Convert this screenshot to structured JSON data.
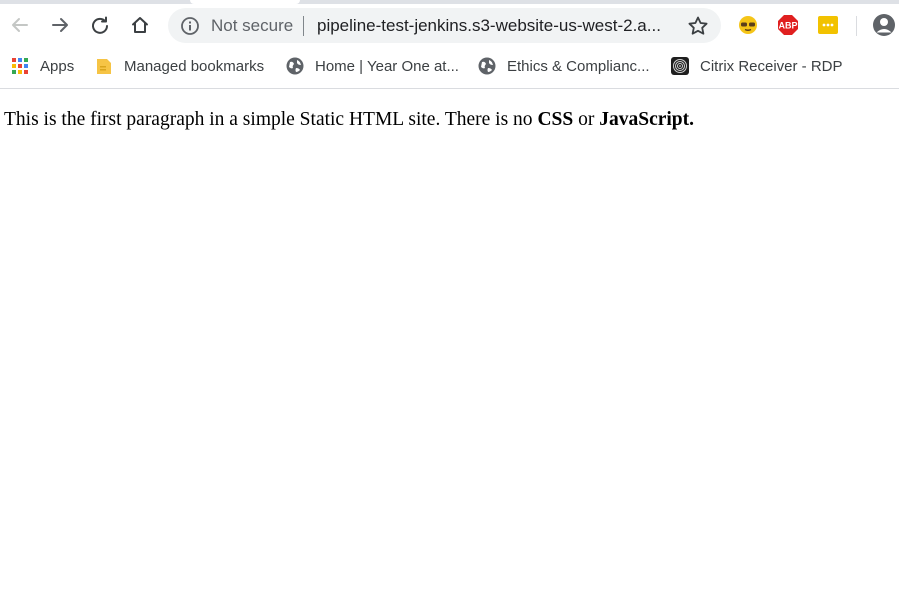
{
  "browser": {
    "security_label": "Not secure",
    "url": "pipeline-test-jenkins.s3-website-us-west-2.a...",
    "extensions": [
      {
        "name": "glasses-extension-icon",
        "color": "#f5c518"
      },
      {
        "name": "adblock-plus-icon",
        "label": "ABP",
        "color": "#e02020"
      },
      {
        "name": "dots-extension-icon",
        "color": "#f2c200"
      }
    ]
  },
  "bookmarks": [
    {
      "label": "Apps",
      "icon": "apps-grid-icon"
    },
    {
      "label": "Managed bookmarks",
      "icon": "folder-icon"
    },
    {
      "label": "Home | Year One at...",
      "icon": "globe-icon"
    },
    {
      "label": "Ethics & Complianc...",
      "icon": "globe-icon"
    },
    {
      "label": "Citrix Receiver - RDP",
      "icon": "citrix-icon"
    }
  ],
  "page": {
    "text_before": "This is the first paragraph in a simple Static HTML site. There is no ",
    "css": "CSS",
    "text_middle": " or ",
    "javascript": "JavaScript."
  }
}
